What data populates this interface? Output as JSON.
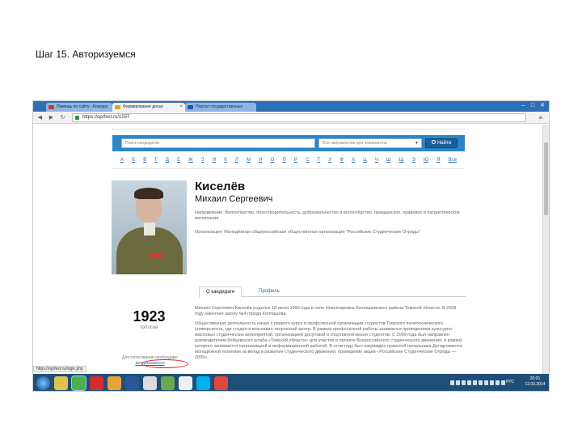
{
  "slide": {
    "title": "Шаг 15. Авторизуемся"
  },
  "browser": {
    "tabs": [
      {
        "label": "Помощь по сайту - Конкурс",
        "favicon_color": "#c0392b"
      },
      {
        "label": "Формирование досье",
        "favicon_color": "#e6a817"
      },
      {
        "label": "Портал государственных",
        "favicon_color": "#2255aa"
      }
    ],
    "url": "https://oprfest.ru/1557",
    "window_controls": {
      "minimize": "–",
      "maximize": "□",
      "close": "✕"
    }
  },
  "page": {
    "search": {
      "placeholder": "Поиск кандидатов",
      "select_value": "Все направления для номинантов",
      "button_label": "Найти"
    },
    "alphabet": [
      "А",
      "Б",
      "В",
      "Г",
      "Д",
      "Е",
      "Ж",
      "З",
      "И",
      "К",
      "Л",
      "М",
      "Н",
      "О",
      "П",
      "Р",
      "С",
      "Т",
      "У",
      "Ф",
      "Х",
      "Ц",
      "Ч",
      "Ш",
      "Щ",
      "Э",
      "Ю",
      "Я",
      "Все"
    ],
    "candidate": {
      "surname": "Киселёв",
      "name": "Михаил Сергеевич",
      "direction_label": "Направление:",
      "direction_value": "Волонтёрство, благотворительность, добровольчество и волонтёрство, гражданское, правовое и патриотическое воспитание",
      "org_label": "Организация:",
      "org_value": "Молодёжная общероссийская общественная организация \"Российские Студенческие Отряды\"",
      "votes": "1923",
      "votes_label": "голосов",
      "vote_hint_prefix": "Для голосования необходимо",
      "vote_hint_link": "авторизоваться"
    },
    "profile_tabs": [
      "О кандидате",
      "Профиль"
    ],
    "bio": [
      "Михаил Сергеевич Киселёв родился 18 июня 1990 года в селе Новопокровка Колпашевского района Томской области. В 2008 году закончил школу №4 города Колпашева.",
      "Общественную деятельность начал с первого курса в профсоюзной организации студентов Томского политехнического университета, где создал и возглавил творческий центр. В рамках профсоюзной работы занимался проведением культурно-массовых студенческих мероприятий, организацией досуговой и спортивной жизни студентов. С 2009 года был направлен руководителем бойцовского штаба «Томской области» для участия в проекте Всероссийского студенческого движения, в рамках которого занимается организацией и информационной работой. В этом году был награждён грамотой начальника Департамента молодёжной политики за вклад в развитие студенческого движения, проведение акции «Российские Студенческие Отряды — 2009»."
    ],
    "status_url": "https://oprfest.ru/login.php"
  },
  "taskbar": {
    "apps": [
      {
        "name": "explorer-icon",
        "color": "#e2c24a"
      },
      {
        "name": "chrome-icon",
        "color": "#4caf50"
      },
      {
        "name": "opera-icon",
        "color": "#d32f2f"
      },
      {
        "name": "media-icon",
        "color": "#e6a23c"
      },
      {
        "name": "word-icon",
        "color": "#2b5797"
      },
      {
        "name": "notepad-icon",
        "color": "#dddddd"
      },
      {
        "name": "stats-icon",
        "color": "#6aa84f"
      },
      {
        "name": "calc-icon",
        "color": "#f0f0f0"
      },
      {
        "name": "skype-icon",
        "color": "#00aff0"
      },
      {
        "name": "pdf-icon",
        "color": "#e04a3a"
      }
    ],
    "lang": "РУС",
    "time": "20:01",
    "date": "12.03.2014"
  }
}
